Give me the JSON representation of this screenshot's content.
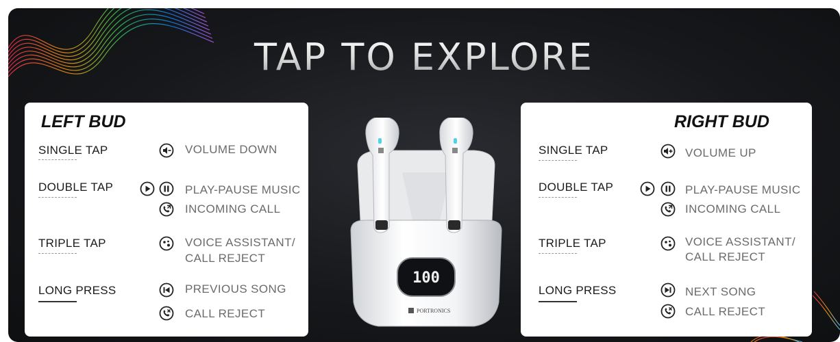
{
  "title": "TAP TO EXPLORE",
  "left": {
    "heading": "LEFT BUD",
    "single_tap": "SINGLE TAP",
    "single_tap_fn": "VOLUME DOWN",
    "double_tap": "DOUBLE TAP",
    "double_tap_fn1": "PLAY-PAUSE MUSIC",
    "double_tap_fn2": "INCOMING CALL",
    "triple_tap": "TRIPLE TAP",
    "triple_tap_fn_line1": "VOICE ASSISTANT/",
    "triple_tap_fn_line2": "CALL REJECT",
    "long_press": "LONG PRESS",
    "long_press_fn1": "PREVIOUS SONG",
    "long_press_fn2": "CALL REJECT"
  },
  "right": {
    "heading": "RIGHT BUD",
    "single_tap": "SINGLE TAP",
    "single_tap_fn": "VOLUME UP",
    "double_tap": "DOUBLE TAP",
    "double_tap_fn1": "PLAY-PAUSE MUSIC",
    "double_tap_fn2": "INCOMING CALL",
    "triple_tap": "TRIPLE TAP",
    "triple_tap_fn_line1": "VOICE ASSISTANT/",
    "triple_tap_fn_line2": "CALL REJECT",
    "long_press": "LONG PRESS",
    "long_press_fn1": "NEXT SONG",
    "long_press_fn2": "CALL REJECT"
  },
  "product": {
    "display_value": "100",
    "brand": "PORTRONICS"
  },
  "colors": {
    "background": "#17181b",
    "card": "#ffffff",
    "action_text": "#1b1b1b",
    "function_text": "#6b6b6b"
  },
  "icons": [
    "volume-down-icon",
    "volume-up-icon",
    "play-icon",
    "pause-icon",
    "incoming-call-icon",
    "voice-assistant-icon",
    "previous-song-icon",
    "next-song-icon",
    "call-reject-icon"
  ]
}
